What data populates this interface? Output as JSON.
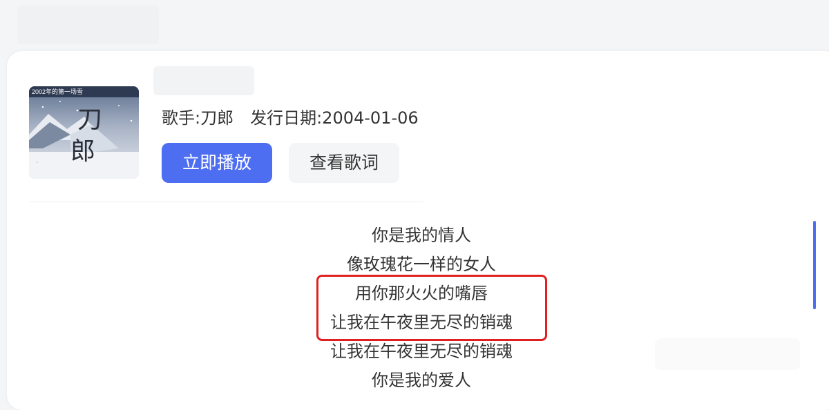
{
  "song": {
    "singer": "歌手:刀郎",
    "release_date": "发行日期:2004-01-06"
  },
  "cover": {
    "banner_text": "2002年的第一场雪",
    "title_chars": [
      "刀",
      "郎"
    ]
  },
  "buttons": {
    "play_label": "立即播放",
    "lyrics_label": "查看歌词"
  },
  "lyrics": [
    "你是我的情人",
    "像玫瑰花一样的女人",
    "用你那火火的嘴唇",
    "让我在午夜里无尽的销魂",
    "让我在午夜里无尽的销魂",
    "你是我的爱人"
  ],
  "highlighted_lines": [
    2,
    3
  ],
  "colors": {
    "accent": "#4e6ef2",
    "highlight_border": "#e02020",
    "text": "#333333"
  }
}
